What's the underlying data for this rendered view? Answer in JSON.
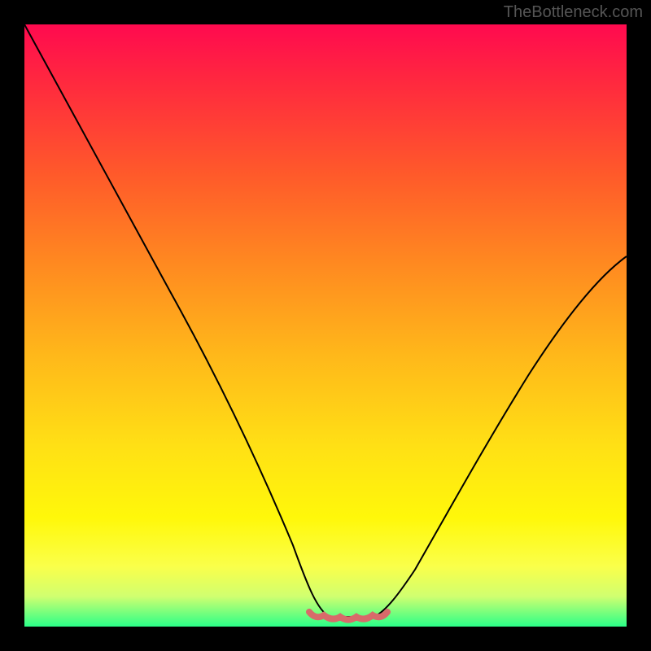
{
  "watermark": "TheBottleneck.com",
  "chart_data": {
    "type": "line",
    "title": "",
    "xlabel": "",
    "ylabel": "",
    "xlim": [
      0,
      100
    ],
    "ylim": [
      0,
      100
    ],
    "series": [
      {
        "name": "bottleneck-curve",
        "x": [
          0,
          6,
          12,
          18,
          24,
          30,
          36,
          42,
          46,
          48,
          50,
          52,
          54,
          56,
          58,
          60,
          64,
          70,
          76,
          82,
          88,
          94,
          100
        ],
        "y": [
          100,
          89,
          78,
          67,
          56,
          45,
          33,
          20,
          10,
          5,
          2,
          1,
          1,
          1,
          2,
          4,
          8,
          16,
          26,
          36,
          46,
          54,
          60
        ]
      }
    ],
    "gradient_stops": [
      {
        "pos": 0,
        "color": "#ff0a4f"
      },
      {
        "pos": 10,
        "color": "#ff2a3e"
      },
      {
        "pos": 25,
        "color": "#ff5a2a"
      },
      {
        "pos": 40,
        "color": "#ff8a20"
      },
      {
        "pos": 55,
        "color": "#ffb81a"
      },
      {
        "pos": 70,
        "color": "#ffe015"
      },
      {
        "pos": 82,
        "color": "#fff80a"
      },
      {
        "pos": 90,
        "color": "#faff4a"
      },
      {
        "pos": 95,
        "color": "#d0ff70"
      },
      {
        "pos": 100,
        "color": "#2bff88"
      }
    ],
    "bottom_marker": {
      "x_start": 48,
      "x_end": 60,
      "color": "#d86a6a"
    }
  }
}
